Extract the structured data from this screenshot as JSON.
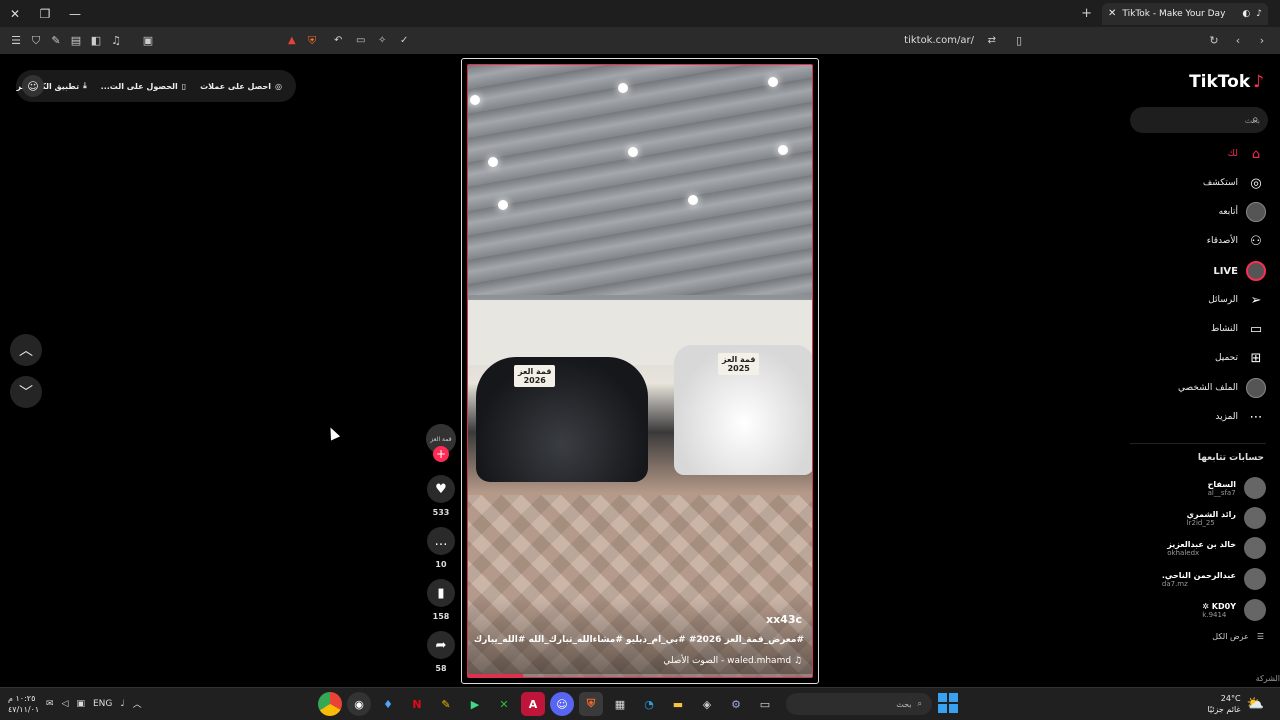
{
  "browser": {
    "tab_title": "TikTok - Make Your Day",
    "url": "tiktok.com/ar/",
    "window_controls": [
      "close-icon",
      "restore-icon",
      "minimize-icon"
    ]
  },
  "topbar": {
    "get_coins": "احصل على عملات",
    "get_app": "الحصول على الت...",
    "desktop_app": "تطبيق الكمبيوتر"
  },
  "video": {
    "watermark": "xx43c",
    "caption": "#معرض_قمة_العز 2026# #بي_ام_دبليو #مشاءالله_تبارك_الله #الله_يبارك_له",
    "music": "waled.mhamd - الصوت الأصلي",
    "plate_left": "2026",
    "plate_right": "2025",
    "sign_left": "قمة العز",
    "sign_right": "قمة العز",
    "progress": 0.16
  },
  "actions": {
    "author_label": "قمة العز",
    "likes": "533",
    "comments": "10",
    "saves": "158",
    "shares": "58"
  },
  "sidebar": {
    "logo": "TikTok",
    "search_placeholder": "بحث",
    "nav": [
      {
        "label": "لك",
        "icon": "home-icon"
      },
      {
        "label": "استكشف",
        "icon": "compass-icon"
      },
      {
        "label": "أتابعه",
        "icon": "avatar"
      },
      {
        "label": "الأصدقاء",
        "icon": "friends-icon"
      },
      {
        "label": "LIVE",
        "icon": "live-icon"
      },
      {
        "label": "الرسائل",
        "icon": "send-icon"
      },
      {
        "label": "النشاط",
        "icon": "activity-icon"
      },
      {
        "label": "تحميل",
        "icon": "upload-icon"
      },
      {
        "label": "الملف الشخصي",
        "icon": "profile-avatar"
      },
      {
        "label": "المزيد",
        "icon": "more-icon"
      }
    ],
    "following_title": "حسابات تتابعها",
    "accounts": [
      {
        "name": "السفاح",
        "user": "al__sfa7"
      },
      {
        "name": "رائد الشمري",
        "user": "lr2id_25"
      },
      {
        "name": "خالد بن عبدالعزيز",
        "user": "okhaledx"
      },
      {
        "name": "عبدالرحمن الناحي.",
        "user": "da7.mz"
      },
      {
        "name": "KD0Y ✲",
        "user": "k.9414"
      }
    ],
    "see_all": "عرض الكل",
    "company": "الشركة"
  },
  "taskbar": {
    "time": "١٠:٢٥ م",
    "date": "٤٧/١١/٠١",
    "language": "ENG",
    "search_placeholder": "بحث",
    "temperature": "24°C",
    "weather_text": "غائم جزئيًا"
  },
  "colors": {
    "accent": "#fe2c55",
    "background": "#000000"
  }
}
